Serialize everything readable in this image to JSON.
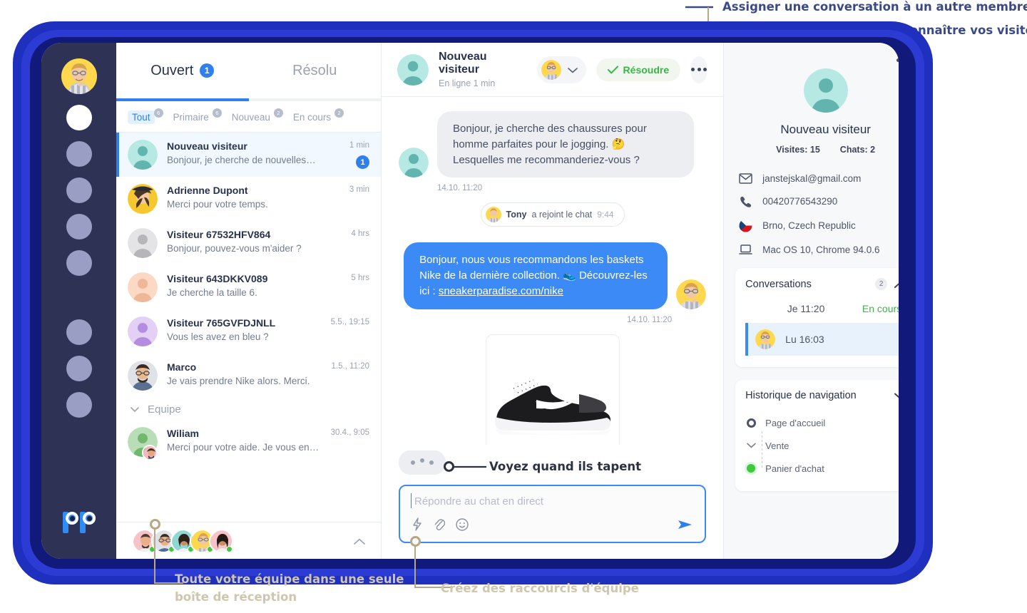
{
  "annotations": {
    "assign": "Assigner une conversation à un autre membre de l'équipe",
    "visitors": "Apprenez à connaître vos visiteurs",
    "typing": "Voyez quand ils tapent",
    "inbox": "Toute votre équipe dans une seule\nboîte de réception",
    "inbox_line1": "Toute votre équipe dans une seule",
    "inbox_line2": "boîte de réception",
    "shortcuts": "Créez des raccourcis d'équipe"
  },
  "toptabs": [
    {
      "label": "Ouvert",
      "badge": "1",
      "selected": true
    },
    {
      "label": "Résolu",
      "badge": "",
      "selected": false
    }
  ],
  "filters": [
    {
      "label": "Tout",
      "badge": "6",
      "selected": true
    },
    {
      "label": "Primaire",
      "badge": "6",
      "selected": false
    },
    {
      "label": "Nouveau",
      "badge": "2",
      "selected": false
    },
    {
      "label": "En cours",
      "badge": "2",
      "selected": false
    }
  ],
  "conversations": [
    {
      "name": "Nouveau visiteur",
      "preview": "Bonjour, je cherche de nouvelles…",
      "time": "1 min",
      "unread": "1",
      "selected": true,
      "avatar": "teal-silhouette"
    },
    {
      "name": "Adrienne Dupont",
      "preview": "Merci pour votre temps.",
      "time": "3 min",
      "unread": "",
      "selected": false,
      "avatar": "photo-woman-hat"
    },
    {
      "name": "Visiteur 67532HFV864",
      "preview": "Bonjour, pouvez-vous m'aider ?",
      "time": "4 hrs",
      "unread": "",
      "selected": false,
      "avatar": "gray-silhouette"
    },
    {
      "name": "Visiteur 643DKKV089",
      "preview": "Je cherche la taille 6.",
      "time": "5 hrs",
      "unread": "",
      "selected": false,
      "avatar": "peach-silhouette"
    },
    {
      "name": "Visiteur 765GVFDJNLL",
      "preview": "Vous les avez en bleu ?",
      "time": "5.5., 19:15",
      "unread": "",
      "selected": false,
      "avatar": "purple-silhouette"
    },
    {
      "name": "Marco",
      "preview": "Je vais prendre Nike alors. Merci.",
      "time": "1.5., 11:20",
      "unread": "",
      "selected": false,
      "avatar": "photo-man-glasses"
    }
  ],
  "group": {
    "label": "Equipe",
    "chevron": "chevron-down-icon"
  },
  "team_conversations": [
    {
      "name": "Wiliam",
      "preview": "Merci pour votre aide. Je vous en remercie.",
      "time": "30.4., 9:05",
      "unread": "",
      "selected": false,
      "avatar": "green-silhouette"
    }
  ],
  "team_bar": {
    "member_count": 5,
    "chevron": "chevron-up-icon"
  },
  "chat_header": {
    "name": "Nouveau visiteur",
    "status": "En ligne 1 min",
    "resolve_label": "Résoudre",
    "check_icon": "check-icon",
    "assignee_chevron": "chevron-down-icon",
    "more_icon": "ellipsis-icon"
  },
  "messages": [
    {
      "kind": "incoming",
      "text": "Bonjour, je cherche des chaussures pour homme parfaites pour le jogging. 🤔 Lesquelles me recommanderiez-vous ?",
      "time": "14.10. 11:20"
    },
    {
      "kind": "system",
      "who": "Tony",
      "action": "a rejoint le chat",
      "time": "9:44"
    },
    {
      "kind": "outgoing",
      "text_before": "Bonjour, nous vous recommandons les baskets Nike de la dernière collection. 👟 Découvrez-les ici : ",
      "link": "sneakerparadise.com/nike",
      "time": "14.10. 11:20"
    },
    {
      "kind": "image",
      "alt": "Nike running shoe product photo"
    }
  ],
  "composer": {
    "placeholder": "Répondre au chat en direct",
    "icons": [
      "shortcut-lightning-icon",
      "attachment-icon",
      "emoji-icon"
    ],
    "send_icon": "send-icon"
  },
  "visitor": {
    "name": "Nouveau visiteur",
    "visits_label": "Visites: 15",
    "chats_label": "Chats: 2",
    "details": [
      {
        "icon": "email-icon",
        "value": "janstejskal@gmail.com"
      },
      {
        "icon": "phone-icon",
        "value": "00420776543290"
      },
      {
        "icon": "flag-czech-icon",
        "value": "Brno, Czech Republic"
      },
      {
        "icon": "device-laptop-icon",
        "value": "Mac OS 10, Chrome 94.0.6"
      }
    ]
  },
  "conversations_card": {
    "title": "Conversations",
    "count": "2",
    "chevron": "chevron-up-icon",
    "items": [
      {
        "when": "Je 11:20",
        "status": "En cours",
        "selected": false
      },
      {
        "when": "Lu 16:03",
        "status": "",
        "selected": true
      }
    ]
  },
  "history_card": {
    "title": "Historique de navigation",
    "chevron": "chevron-down-icon",
    "items": [
      {
        "label": "Page d'accueil",
        "marker": "ring-marker"
      },
      {
        "label": "Vente",
        "marker": "chevron-down-icon"
      },
      {
        "label": "Panier d'achat",
        "marker": "green-dot-marker"
      }
    ]
  },
  "colors": {
    "accent_blue": "#2f80ed",
    "bubble_blue": "#3b8af5",
    "resolve_green": "#3cb44a",
    "rail_dark": "#2e3356",
    "frame_blue": "#1f2fbe",
    "annotation_navy": "#3b4a86"
  }
}
